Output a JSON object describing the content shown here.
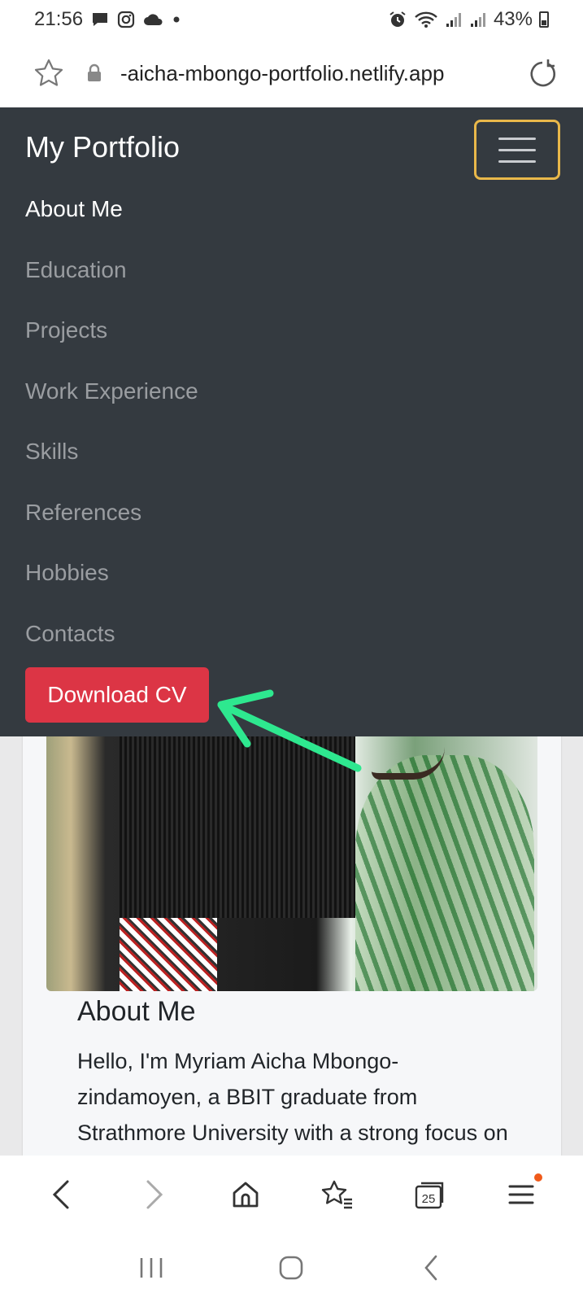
{
  "status_bar": {
    "time": "21:56",
    "battery": "43%"
  },
  "browser": {
    "url": "-aicha-mbongo-portfolio.netlify.app",
    "tab_count": "25"
  },
  "navbar": {
    "brand": "My Portfolio",
    "items": [
      {
        "label": "About Me",
        "active": true
      },
      {
        "label": "Education",
        "active": false
      },
      {
        "label": "Projects",
        "active": false
      },
      {
        "label": "Work Experience",
        "active": false
      },
      {
        "label": "Skills",
        "active": false
      },
      {
        "label": "References",
        "active": false
      },
      {
        "label": "Hobbies",
        "active": false
      },
      {
        "label": "Contacts",
        "active": false
      }
    ],
    "cv_button": "Download CV"
  },
  "about": {
    "title": "About Me",
    "text": "Hello, I'm Myriam Aicha Mbongo-zindamoyen, a BBIT graduate from Strathmore University with a strong focus on Business and IT. As a creative junior front-end developer, I'm"
  },
  "colors": {
    "navbar_bg": "#343a40",
    "cv_button": "#dc3545",
    "toggler_focus": "#e9b84a",
    "annotation_arrow": "#2ee88f",
    "notification_dot": "#f05a1a"
  },
  "icons": {
    "status_left": [
      "chat-icon",
      "instagram-icon",
      "cloud-icon",
      "dot-icon"
    ],
    "status_right": [
      "alarm-icon",
      "wifi-icon",
      "signal-icon",
      "signal-icon",
      "battery-icon"
    ],
    "url_bar": [
      "star-icon",
      "lock-icon",
      "reload-icon"
    ],
    "toolbar": [
      "back-icon",
      "forward-icon",
      "home-icon",
      "bookmarks-icon",
      "tabs-icon",
      "menu-icon"
    ],
    "android_nav": [
      "recents-icon",
      "home-button-icon",
      "back-icon"
    ]
  }
}
